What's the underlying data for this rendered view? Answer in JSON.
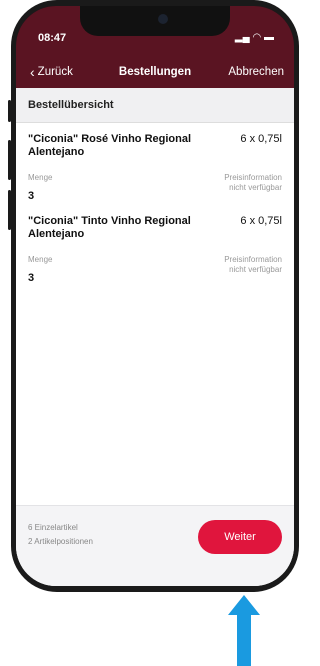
{
  "status_bar": {
    "time": "08:47",
    "icons": "‥ᵐ ◠ ▬"
  },
  "nav": {
    "back_label": "Zurück",
    "title": "Bestellungen",
    "cancel_label": "Abbrechen"
  },
  "section_header": "Bestellübersicht",
  "items": [
    {
      "name": "\"Ciconia\" Rosé Vinho Regional Alentejano",
      "size": "6 x 0,75l",
      "qty_label": "Menge",
      "qty": "3",
      "price_info": "Preisinformation nicht verfügbar"
    },
    {
      "name": "\"Ciconia\" Tinto Vinho Regional Alentejano",
      "size": "6 x 0,75l",
      "qty_label": "Menge",
      "qty": "3",
      "price_info": "Preisinformation nicht verfügbar"
    }
  ],
  "footer": {
    "summary_line1": "6 Einzelartikel",
    "summary_line2": "2 Artikelpositionen",
    "next_label": "Weiter"
  },
  "colors": {
    "header_bg": "#5a1422",
    "accent": "#e0153d",
    "arrow": "#1a9ae0"
  }
}
